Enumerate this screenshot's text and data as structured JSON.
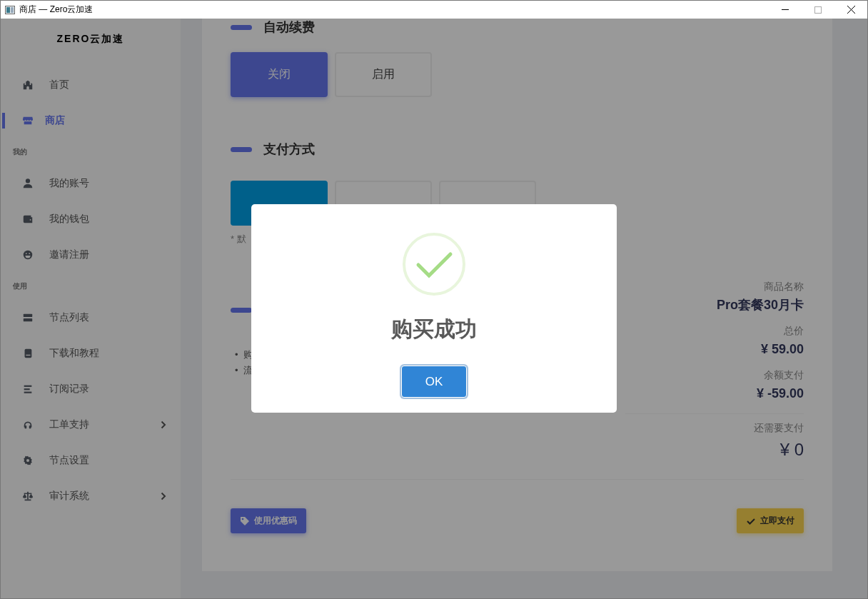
{
  "window": {
    "title": "商店 — Zero云加速"
  },
  "sidebar": {
    "brand": "ZERO云加速",
    "sections": [
      {
        "items": [
          {
            "label": "首页",
            "selected": false,
            "kind": "link"
          },
          {
            "label": "商店",
            "selected": true,
            "kind": "link"
          }
        ]
      },
      {
        "heading": "我的",
        "items": [
          {
            "label": "我的账号",
            "selected": false,
            "kind": "link"
          },
          {
            "label": "我的钱包",
            "selected": false,
            "kind": "link"
          },
          {
            "label": "邀请注册",
            "selected": false,
            "kind": "link"
          }
        ]
      },
      {
        "heading": "使用",
        "items": [
          {
            "label": "节点列表",
            "selected": false,
            "kind": "link"
          },
          {
            "label": "下载和教程",
            "selected": false,
            "kind": "link"
          },
          {
            "label": "订阅记录",
            "selected": false,
            "kind": "link"
          },
          {
            "label": "工单支持",
            "selected": false,
            "kind": "dropdown"
          },
          {
            "label": "节点设置",
            "selected": false,
            "kind": "link"
          },
          {
            "label": "审计系统",
            "selected": false,
            "kind": "dropdown"
          }
        ]
      }
    ]
  },
  "auto_renew": {
    "title": "自动续费",
    "options": [
      {
        "label": "关闭",
        "selected": true
      },
      {
        "label": "启用",
        "selected": false
      }
    ]
  },
  "payment": {
    "title": "支付方式",
    "methods": [
      {
        "selected": true
      },
      {
        "selected": false
      },
      {
        "selected": false
      }
    ],
    "note": "* 默"
  },
  "notes": {
    "items": [
      {
        "marker": "•",
        "text": "购"
      },
      {
        "marker": "•",
        "text": "流"
      }
    ]
  },
  "summary": {
    "rows": [
      {
        "label": "商品名称",
        "value": "Pro套餐30月卡"
      },
      {
        "label": "总价",
        "value": "¥ 59.00"
      },
      {
        "label": "余额支付",
        "value": "¥ -59.00"
      }
    ],
    "due": {
      "label": "还需要支付",
      "value": "¥ 0"
    }
  },
  "actions": [
    {
      "label": "使用优惠码",
      "kind": "coupon"
    },
    {
      "label": "立即支付",
      "kind": "pay"
    }
  ],
  "dialog": {
    "kind": "success",
    "title": "购买成功",
    "button": "OK"
  }
}
